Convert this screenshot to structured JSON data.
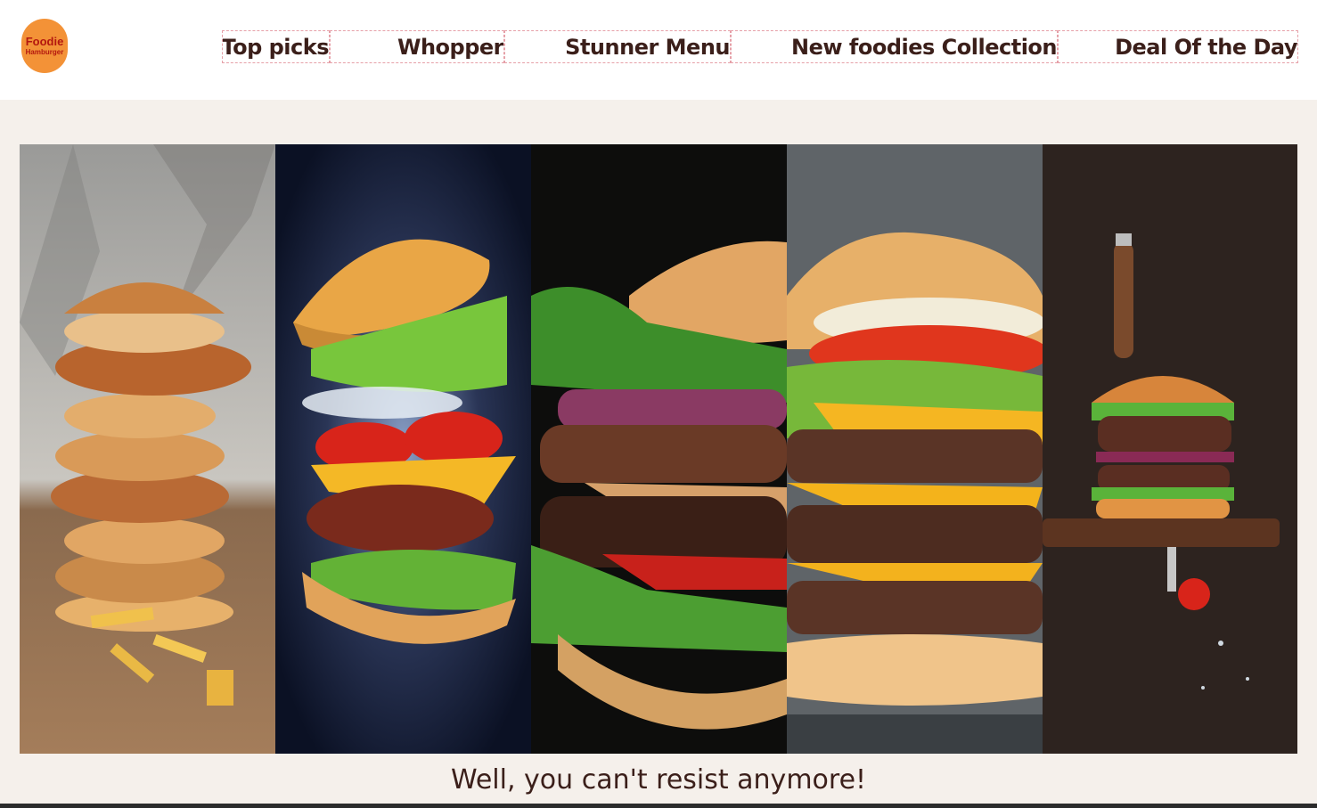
{
  "logo": {
    "line1": "Foodie",
    "line2": "Hamburger"
  },
  "nav": [
    {
      "label": "Top picks"
    },
    {
      "label": "Whopper"
    },
    {
      "label": "Stunner Menu"
    },
    {
      "label": "New foodies Collection"
    },
    {
      "label": "Deal Of the Day"
    }
  ],
  "hero": {
    "panels": [
      {
        "name": "stacked-chicken-burger-image"
      },
      {
        "name": "flying-ingredients-burger-image"
      },
      {
        "name": "double-patty-burger-closeup-image"
      },
      {
        "name": "cheese-triple-burger-image"
      },
      {
        "name": "knife-burger-on-board-image"
      }
    ]
  },
  "tagline": "Well, you can't resist anymore!",
  "colors": {
    "accent": "#f39237",
    "text": "#3b1f1a",
    "background": "#f5f0eb"
  }
}
